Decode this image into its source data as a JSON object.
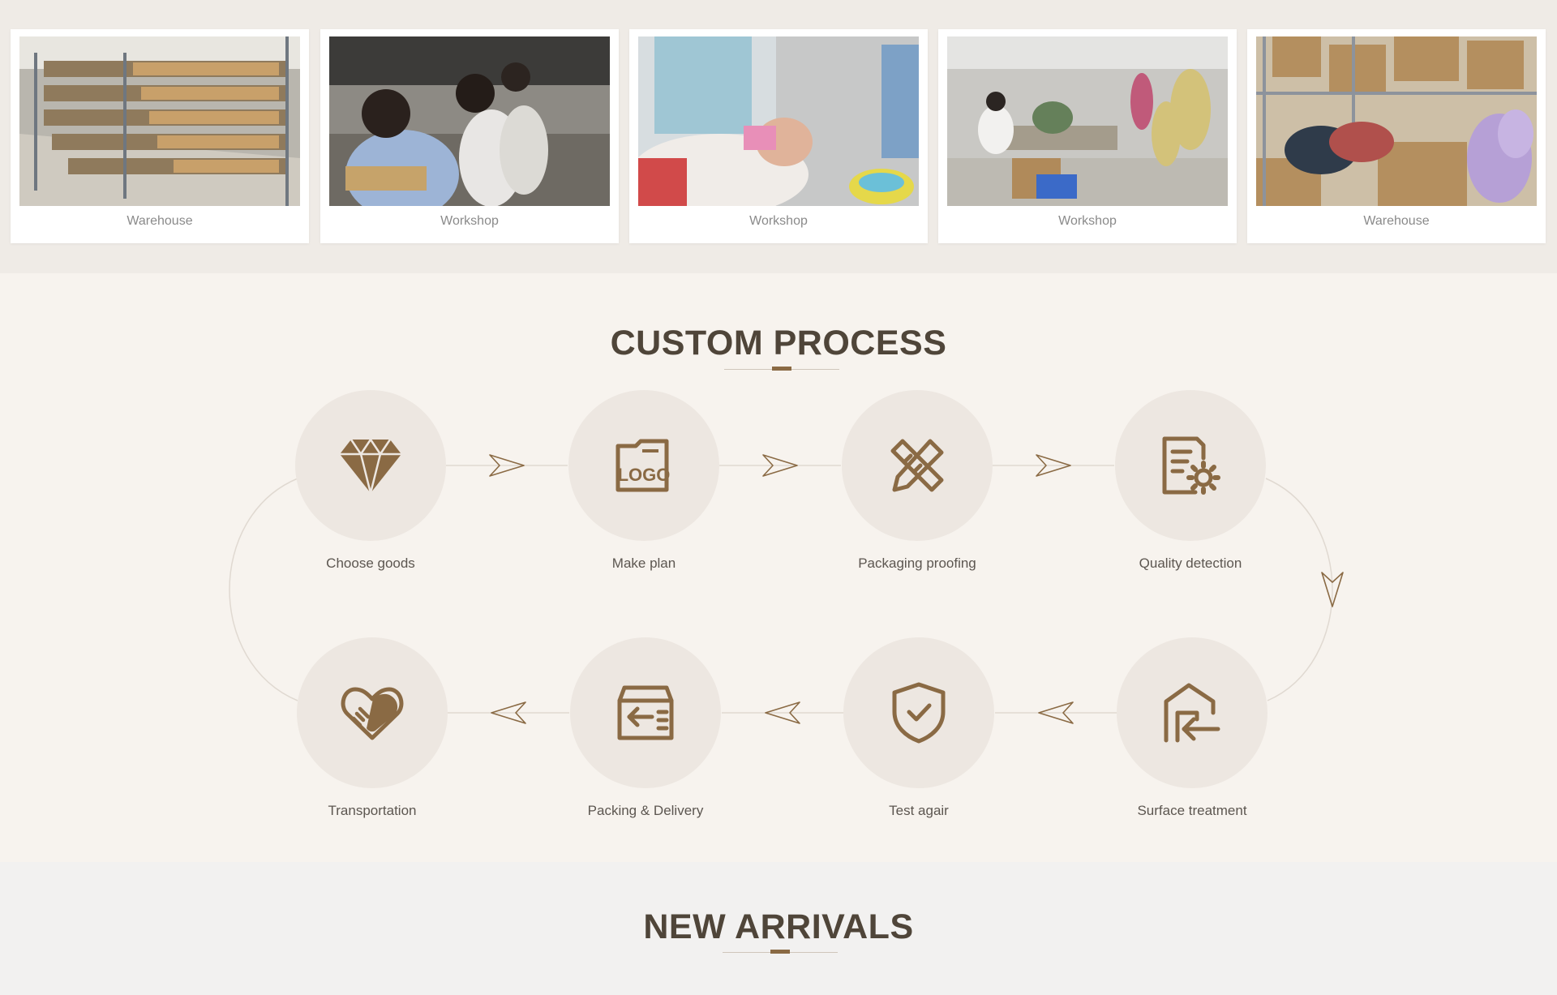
{
  "gallery": {
    "cards": [
      {
        "caption": "Warehouse"
      },
      {
        "caption": "Workshop"
      },
      {
        "caption": "Workshop"
      },
      {
        "caption": "Workshop"
      },
      {
        "caption": "Warehouse"
      }
    ]
  },
  "process": {
    "title": "CUSTOM PROCESS",
    "steps": [
      {
        "label": "Choose goods",
        "icon": "diamond-icon"
      },
      {
        "label": "Make plan",
        "icon": "logo-folder-icon"
      },
      {
        "label": "Packaging proofing",
        "icon": "pencil-ruler-icon"
      },
      {
        "label": "Quality detection",
        "icon": "document-gear-icon"
      },
      {
        "label": "Surface treatment",
        "icon": "house-arrow-icon"
      },
      {
        "label": "Test agair",
        "icon": "shield-check-icon"
      },
      {
        "label": "Packing & Delivery",
        "icon": "box-arrow-icon"
      },
      {
        "label": "Transportation",
        "icon": "handshake-icon"
      }
    ]
  },
  "arrivals": {
    "title": "NEW ARRIVALS"
  },
  "colors": {
    "accent": "#8a6a44",
    "title": "#4f4539",
    "circle": "#ede7e1",
    "section_bg": "#f7f3ee"
  }
}
